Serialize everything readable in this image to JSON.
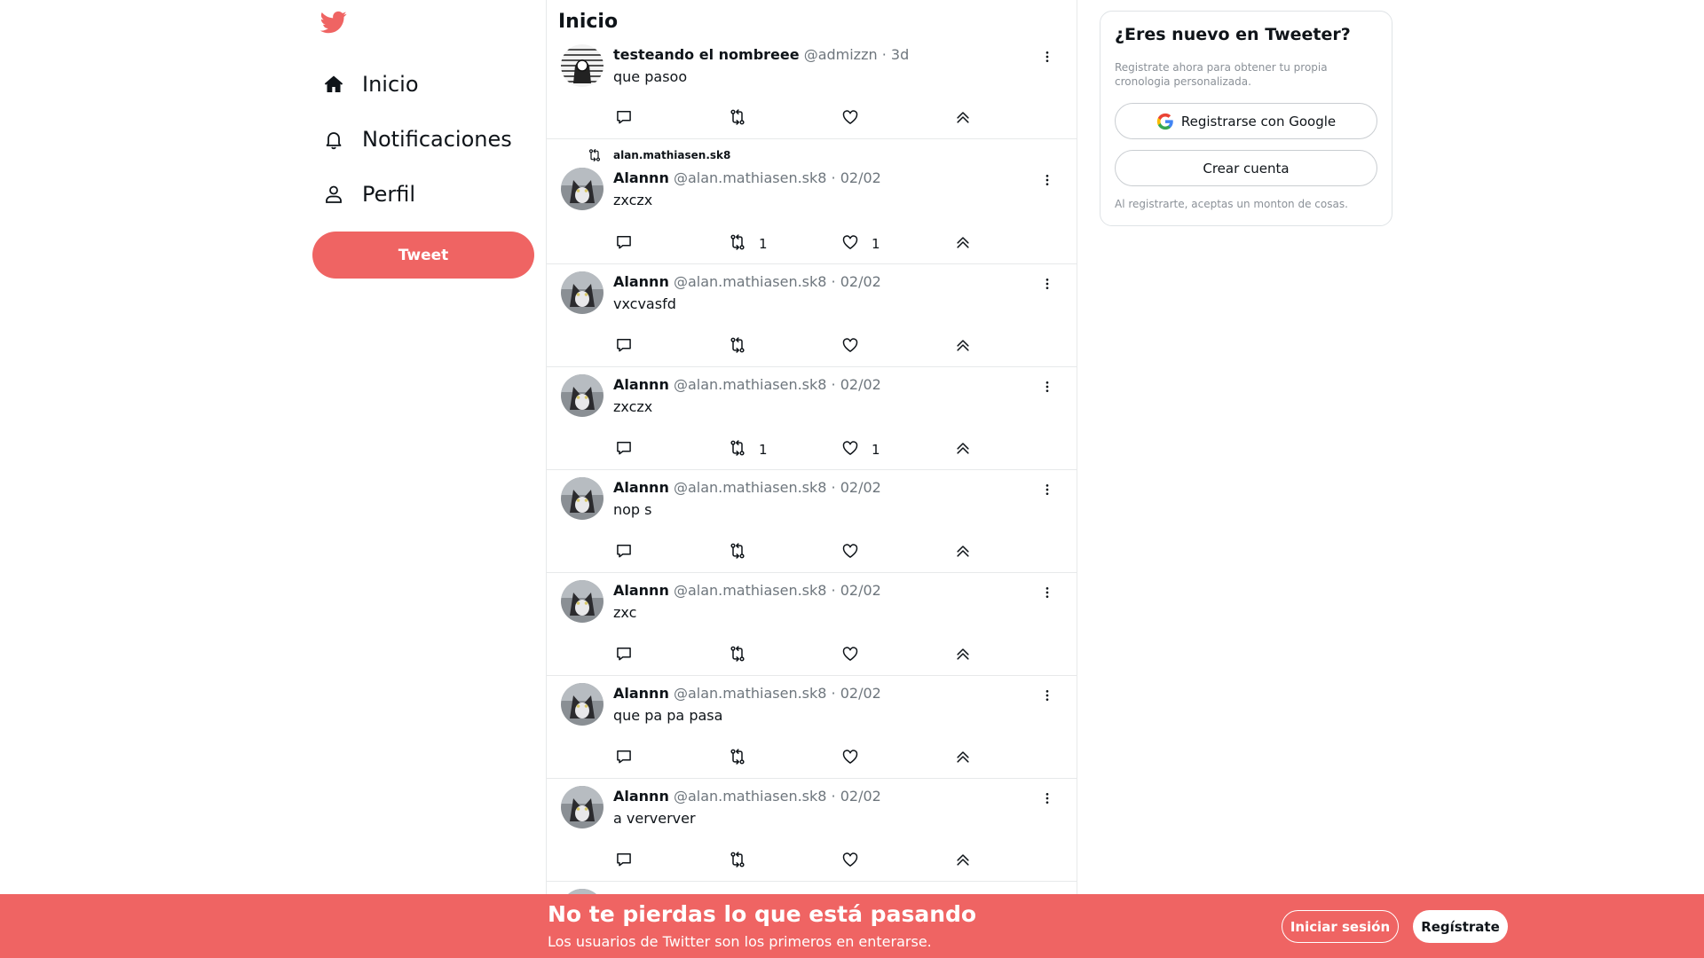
{
  "colors": {
    "brand": "#ef6463",
    "text": "#0f1419",
    "muted": "#6e767d",
    "border": "#e7e9ea"
  },
  "sidebar": {
    "logo_icon": "bird-icon",
    "items": [
      {
        "label": "Inicio",
        "icon": "home-icon"
      },
      {
        "label": "Notificaciones",
        "icon": "bell-icon"
      },
      {
        "label": "Perfil",
        "icon": "user-icon"
      }
    ],
    "tweet_button": "Tweet"
  },
  "feed": {
    "title": "Inicio",
    "tweets": [
      {
        "retweeted_by": "",
        "name": "testeando el nombreee",
        "handle": "@admizzn",
        "date": "3d",
        "text": "que pasoo",
        "retweets": "",
        "likes": ""
      },
      {
        "retweeted_by": "alan.mathiasen.sk8",
        "name": "Alannn",
        "handle": "@alan.mathiasen.sk8",
        "date": "02/02",
        "text": "zxczx",
        "retweets": "1",
        "likes": "1"
      },
      {
        "retweeted_by": "",
        "name": "Alannn",
        "handle": "@alan.mathiasen.sk8",
        "date": "02/02",
        "text": "vxcvasfd",
        "retweets": "",
        "likes": ""
      },
      {
        "retweeted_by": "",
        "name": "Alannn",
        "handle": "@alan.mathiasen.sk8",
        "date": "02/02",
        "text": "zxczx",
        "retweets": "1",
        "likes": "1"
      },
      {
        "retweeted_by": "",
        "name": "Alannn",
        "handle": "@alan.mathiasen.sk8",
        "date": "02/02",
        "text": "nop s",
        "retweets": "",
        "likes": ""
      },
      {
        "retweeted_by": "",
        "name": "Alannn",
        "handle": "@alan.mathiasen.sk8",
        "date": "02/02",
        "text": "zxc",
        "retweets": "",
        "likes": ""
      },
      {
        "retweeted_by": "",
        "name": "Alannn",
        "handle": "@alan.mathiasen.sk8",
        "date": "02/02",
        "text": "que pa pa pasa",
        "retweets": "",
        "likes": ""
      },
      {
        "retweeted_by": "",
        "name": "Alannn",
        "handle": "@alan.mathiasen.sk8",
        "date": "02/02",
        "text": "a ververver",
        "retweets": "",
        "likes": ""
      }
    ]
  },
  "signup_card": {
    "title": "¿Eres nuevo en Tweeter?",
    "subtitle": "Registrate ahora para obtener tu propia cronologia personalizada.",
    "google_button": "Registrarse con Google",
    "create_button": "Crear cuenta",
    "legal": "Al registrarte, aceptas un monton de cosas."
  },
  "bottom_bar": {
    "title": "No te pierdas lo que está pasando",
    "subtitle": "Los usuarios de Twitter son los primeros en enterarse.",
    "login_button": "Iniciar sesión",
    "signup_button": "Regístrate"
  }
}
